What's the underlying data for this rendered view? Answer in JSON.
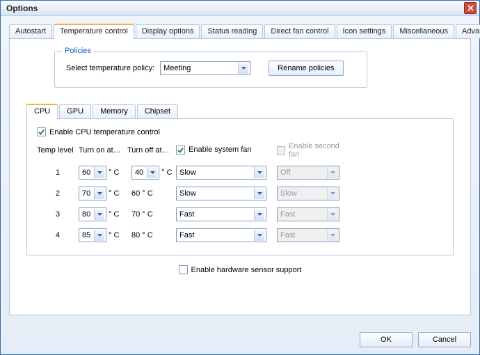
{
  "window": {
    "title": "Options"
  },
  "tabs": {
    "main": [
      "Autostart",
      "Temperature control",
      "Display options",
      "Status reading",
      "Direct fan control",
      "Icon settings",
      "Miscellaneous",
      "Advanced"
    ],
    "inner": [
      "CPU",
      "GPU",
      "Memory",
      "Chipset"
    ]
  },
  "policies": {
    "legend": "Policies",
    "select_label": "Select temperature policy:",
    "selected": "Meeting",
    "rename_btn": "Rename policies"
  },
  "cpu": {
    "enable_label": "Enable CPU temperature control",
    "headers": {
      "level": "Temp level",
      "on": "Turn on at…",
      "off": "Turn off at…"
    },
    "system_fan": "Enable system fan",
    "second_fan": "Enable second fan",
    "rows": [
      {
        "level": "1",
        "on": "60",
        "off": "40",
        "fan1": "Slow",
        "fan2": "Off"
      },
      {
        "level": "2",
        "on": "70",
        "off": "60 ° C",
        "fan1": "Slow",
        "fan2": "Slow"
      },
      {
        "level": "3",
        "on": "80",
        "off": "70 ° C",
        "fan1": "Fast",
        "fan2": "Fast"
      },
      {
        "level": "4",
        "on": "85",
        "off": "80 ° C",
        "fan1": "Fast",
        "fan2": "Fast"
      }
    ],
    "degc": "° C"
  },
  "hw_sensor": "Enable hardware sensor support",
  "footer": {
    "ok": "OK",
    "cancel": "Cancel"
  }
}
